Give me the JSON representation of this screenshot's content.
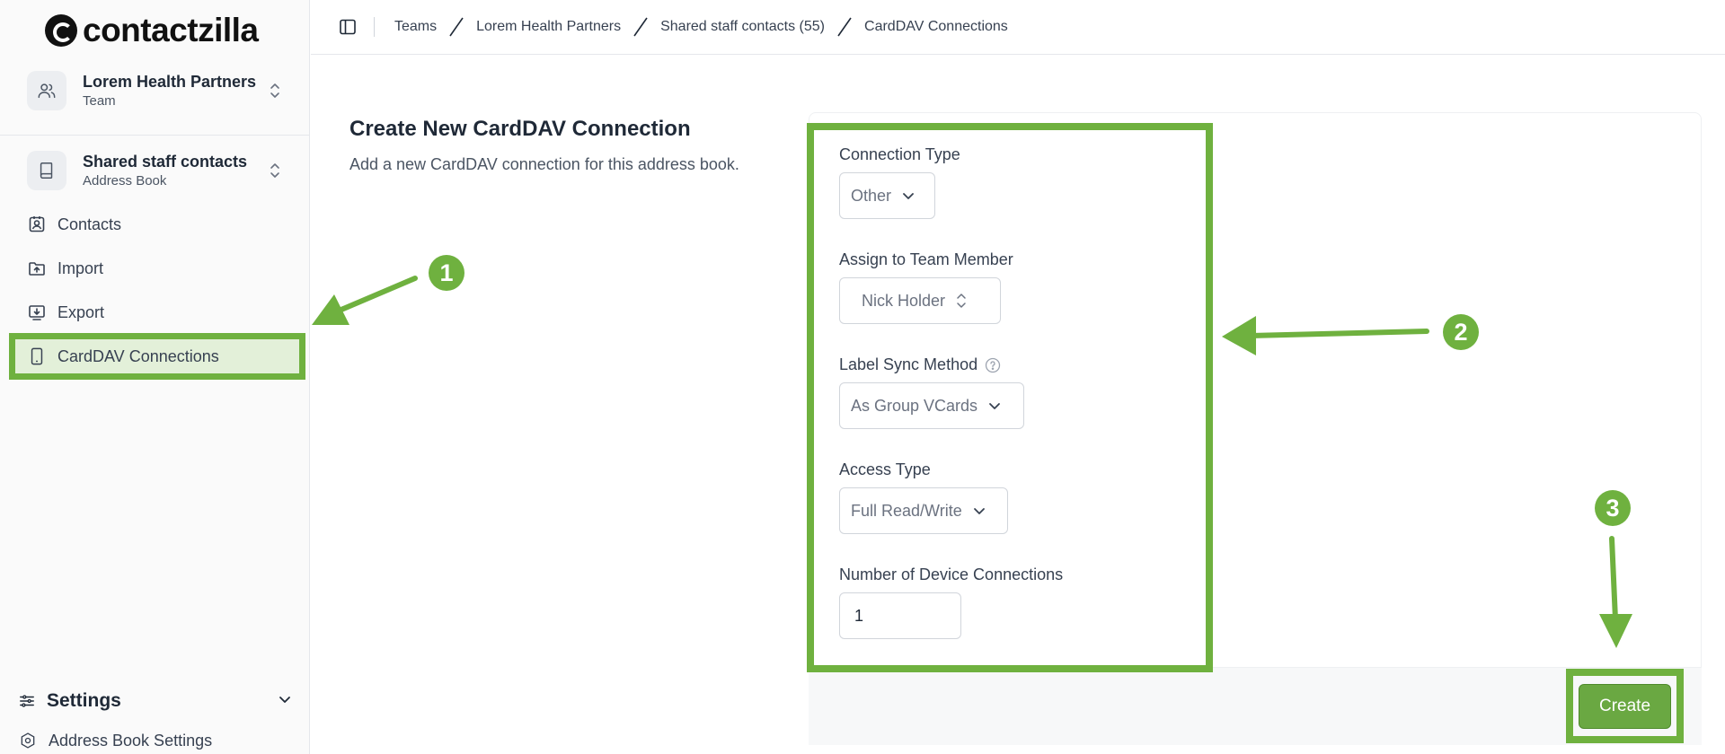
{
  "app": {
    "logo_text": "contactzilla"
  },
  "team_switcher": {
    "title": "Lorem Health Partners",
    "subtitle": "Team"
  },
  "book_switcher": {
    "title": "Shared staff contacts",
    "subtitle": "Address Book"
  },
  "nav": {
    "items": [
      {
        "label": "Contacts",
        "icon": "contacts-icon"
      },
      {
        "label": "Import",
        "icon": "import-icon"
      },
      {
        "label": "Export",
        "icon": "export-icon"
      },
      {
        "label": "CardDAV Connections",
        "icon": "device-icon",
        "active": true
      }
    ]
  },
  "settings": {
    "label": "Settings",
    "sub_label": "Address Book Settings"
  },
  "breadcrumb": [
    "Teams",
    "Lorem Health Partners",
    "Shared staff contacts (55)",
    "CardDAV Connections"
  ],
  "page": {
    "title": "Create New CardDAV Connection",
    "description": "Add a new CardDAV connection for this address book."
  },
  "form": {
    "connection_type": {
      "label": "Connection Type",
      "value": "Other"
    },
    "assign_member": {
      "label": "Assign to Team Member",
      "value": "Nick Holder"
    },
    "label_sync": {
      "label": "Label Sync Method",
      "value": "As Group VCards"
    },
    "access_type": {
      "label": "Access Type",
      "value": "Full Read/Write"
    },
    "device_connections": {
      "label": "Number of Device Connections",
      "value": "1"
    },
    "create_label": "Create"
  },
  "annotations": [
    "1",
    "2",
    "3"
  ],
  "colors": {
    "accent_green": "#6fb13f",
    "active_bg": "#e3f0d9",
    "button_green": "#6aa842"
  }
}
